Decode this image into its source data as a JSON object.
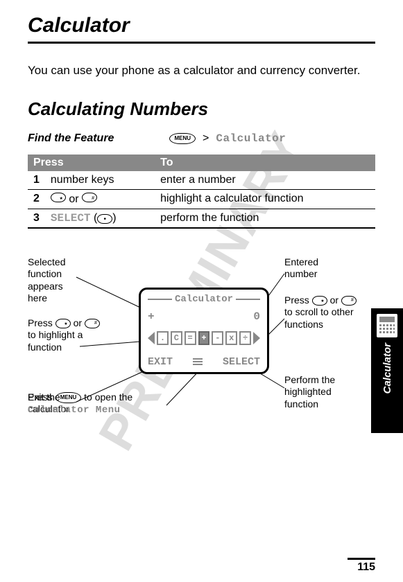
{
  "watermark": "PRELIMINARY",
  "title": "Calculator",
  "intro": "You can use your phone as a calculator and currency converter.",
  "section_heading": "Calculating Numbers",
  "feature": {
    "label": "Find the Feature",
    "menu_key": "MENU",
    "gt": ">",
    "target": "Calculator"
  },
  "table": {
    "col_press": "Press",
    "col_to": "To",
    "rows": [
      {
        "n": "1",
        "press": "number keys",
        "to": "enter a number"
      },
      {
        "n": "2",
        "press_star": "★",
        "press_or": " or ",
        "press_hash": "#",
        "to": "highlight a calculator function"
      },
      {
        "n": "3",
        "press_select": "SELECT",
        "press_paren_open": " (",
        "press_paren_close": ")",
        "to": "perform the function"
      }
    ]
  },
  "side_tab": {
    "label": "Calculator"
  },
  "phone": {
    "title": "Calculator",
    "disp_left": "+",
    "disp_right": "0",
    "functions": [
      ".",
      "C",
      "=",
      "+",
      "-",
      "x",
      "÷"
    ],
    "active_fn_index": 3,
    "softkey_left": "EXIT",
    "softkey_right": "SELECT"
  },
  "callouts": {
    "sel_fn": "Selected function appears here",
    "press_hl_prefix": "Press ",
    "press_hl_or": " or ",
    "press_hl_suffix": " to highlight a function",
    "exit": "Exit the calculator",
    "menu_open_prefix": "Press ",
    "menu_open_suffix": " to open the ",
    "menu_name": "Calculator Menu",
    "entered": "Entered number",
    "scroll_prefix": "Press ",
    "scroll_or": " or ",
    "scroll_suffix": " to scroll to other functions",
    "perform": "Perform the highlighted function"
  },
  "page_number": "115"
}
